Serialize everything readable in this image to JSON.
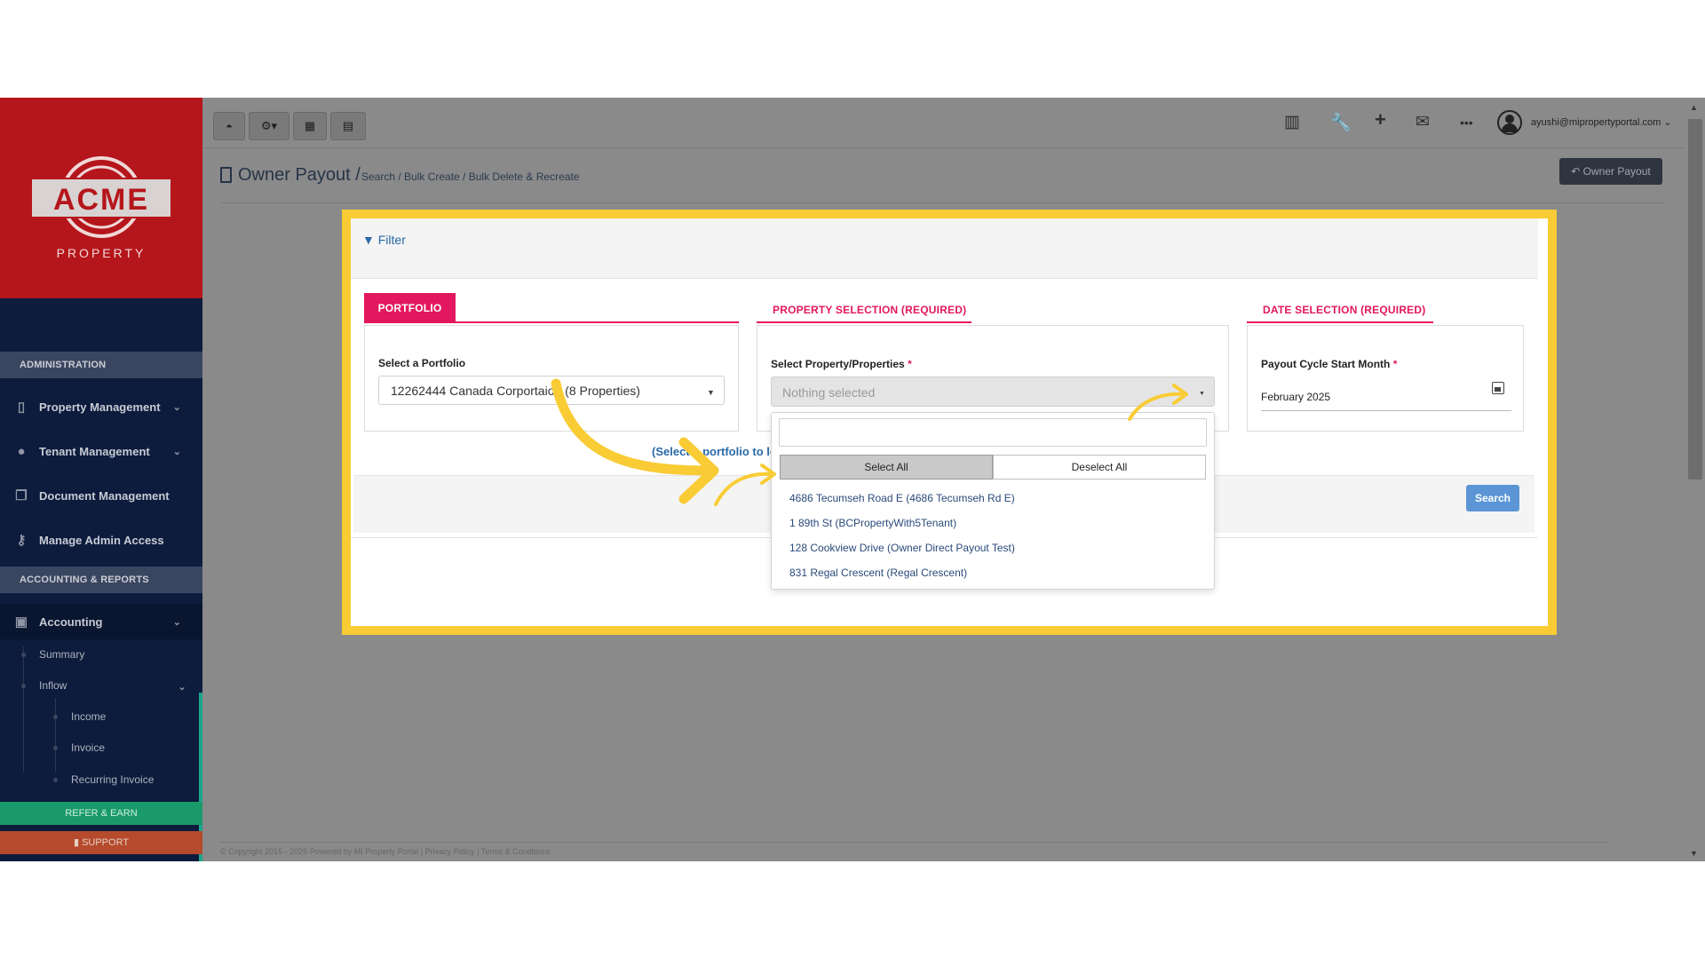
{
  "brand": {
    "logo_text": "ACME",
    "logo_sub": "PROPERTY"
  },
  "sidebar": {
    "sections": [
      {
        "label": "ADMINISTRATION"
      },
      {
        "label": "ACCOUNTING & REPORTS"
      }
    ],
    "items": [
      {
        "label": "Property Management",
        "icon": "building-icon"
      },
      {
        "label": "Tenant Management",
        "icon": "users-icon"
      },
      {
        "label": "Document Management",
        "icon": "documents-icon"
      },
      {
        "label": "Manage Admin Access",
        "icon": "key-icon"
      },
      {
        "label": "Accounting",
        "icon": "money-icon"
      }
    ],
    "sub_items": [
      {
        "label": "Summary"
      },
      {
        "label": "Inflow"
      },
      {
        "label": "Income"
      },
      {
        "label": "Invoice"
      },
      {
        "label": "Recurring Invoice"
      }
    ],
    "refer_label": "REFER & EARN",
    "support_label": "SUPPORT"
  },
  "topbar": {
    "user_email": "ayushi@mipropertyportal.com"
  },
  "page": {
    "title": "Owner Payout /",
    "breadcrumb": "Search / Bulk Create / Bulk Delete & Recreate",
    "owner_button": "Owner Payout",
    "footer": "© Copyright 2015 - 2025 Powered by MI Property Portal | Privacy Policy | Terms & Conditions"
  },
  "filter": {
    "label": "Filter",
    "portfolio": {
      "tab": "PORTFOLIO",
      "field_label": "Select a Portfolio",
      "value": "12262444 Canada Corportaion (8 Properties)",
      "helper": "(Select a portfolio to load properties)"
    },
    "property": {
      "tab": "PROPERTY SELECTION (REQUIRED)",
      "field_label": "Select Property/Properties",
      "required_mark": "*",
      "placeholder": "Nothing selected",
      "select_all": "Select All",
      "deselect_all": "Deselect All",
      "options": [
        "4686 Tecumseh Road E (4686 Tecumseh Rd E)",
        "1 89th St (BCPropertyWith5Tenant)",
        "128 Cookview Drive (Owner Direct Payout Test)",
        "831 Regal Crescent (Regal Crescent)"
      ]
    },
    "date": {
      "tab": "DATE SELECTION (REQUIRED)",
      "field_label": "Payout Cycle Start Month",
      "required_mark": "*",
      "value": "February 2025"
    },
    "search_button": "Search"
  },
  "colors": {
    "accent": "#e3175e",
    "highlight": "#f9cc35",
    "sidebar": "#0d1b3d",
    "logo_bg": "#b5161b"
  }
}
